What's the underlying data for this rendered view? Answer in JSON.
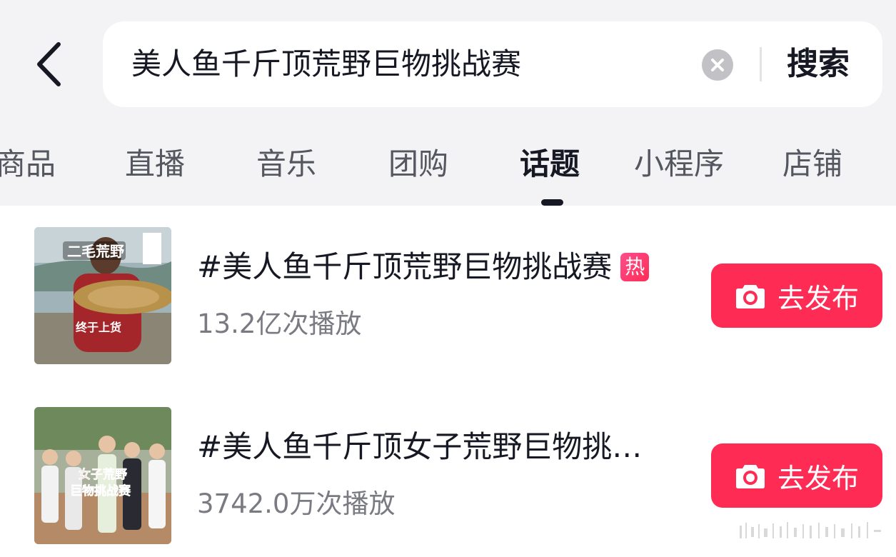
{
  "search": {
    "query": "美人鱼千斤顶荒野巨物挑战赛",
    "button_label": "搜索"
  },
  "tabs": [
    {
      "label": "商品",
      "active": false
    },
    {
      "label": "直播",
      "active": false
    },
    {
      "label": "音乐",
      "active": false
    },
    {
      "label": "团购",
      "active": false
    },
    {
      "label": "话题",
      "active": true
    },
    {
      "label": "小程序",
      "active": false
    },
    {
      "label": "店铺",
      "active": false
    }
  ],
  "results": [
    {
      "thumbnail_label": "thumb-fisherman-carp",
      "title": "#美人鱼千斤顶荒野巨物挑战赛",
      "hot_badge": "热",
      "views": "13.2亿次播放",
      "publish_label": "去发布"
    },
    {
      "thumbnail_label": "thumb-women-group",
      "title": "#美人鱼千斤顶女子荒野巨物挑…",
      "views": "3742.0万次播放",
      "publish_label": "去发布"
    }
  ],
  "colors": {
    "accent": "#fe2c55",
    "top_background": "#f3f3f5",
    "text_primary": "#161823",
    "text_secondary": "#7a7b82"
  },
  "icons": [
    "chevron-left-icon",
    "clear-icon",
    "camera-icon",
    "hot-badge"
  ]
}
